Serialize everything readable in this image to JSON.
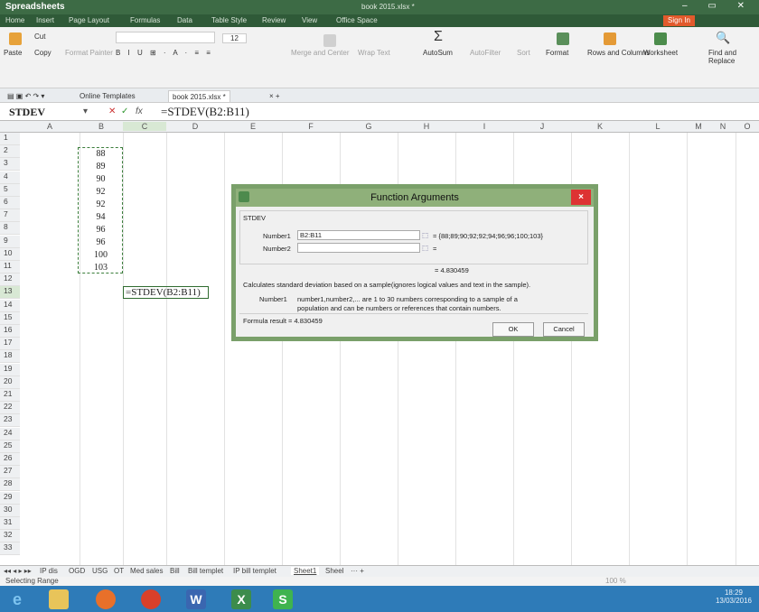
{
  "titlebar": {
    "app_name": "Spreadsheets",
    "doc_title": "book 2015.xlsx *"
  },
  "menu": {
    "items": [
      "Home",
      "Insert",
      "Page Layout",
      "Formulas",
      "Data",
      "Table Style",
      "Review",
      "View",
      "Office Space"
    ],
    "sign_in": "Sign In"
  },
  "ribbon": {
    "cut": "Cut",
    "copy": "Copy",
    "paste": "Paste",
    "format_painter": "Format Painter",
    "font_size": "12",
    "merge": "Merge and Center",
    "wrap": "Wrap Text",
    "autosum": "AutoSum",
    "autofilter": "AutoFilter",
    "sort": "Sort",
    "format": "Format",
    "rows_cols": "Rows and Columns",
    "worksheet": "Worksheet",
    "find": "Find and Replace"
  },
  "doc_tabs": [
    "Online Templates",
    "book 2015.xlsx *"
  ],
  "formula_bar": {
    "name_box": "STDEV",
    "formula": "=STDEV(B2:B11)"
  },
  "columns": [
    "A",
    "B",
    "C",
    "D",
    "E",
    "F",
    "G",
    "H",
    "I",
    "J",
    "K",
    "L",
    "M",
    "N",
    "O"
  ],
  "rows": [
    "1",
    "2",
    "3",
    "4",
    "5",
    "6",
    "7",
    "8",
    "9",
    "10",
    "11",
    "12",
    "13",
    "14",
    "15",
    "16",
    "17",
    "18",
    "19",
    "20",
    "21",
    "22",
    "23",
    "24",
    "25",
    "26",
    "27",
    "28",
    "29",
    "30",
    "31",
    "32",
    "33"
  ],
  "cells": {
    "b_values": [
      "88",
      "89",
      "90",
      "92",
      "92",
      "94",
      "96",
      "96",
      "100",
      "103"
    ],
    "c13": "=STDEV(B2:B11)"
  },
  "dialog": {
    "title": "Function Arguments",
    "function_name": "STDEV",
    "number1_label": "Number1",
    "number1_value": "B2:B11",
    "number1_result": "= {88;89;90;92;92;94;96;96;100;103}",
    "number2_label": "Number2",
    "number2_result": "=",
    "result_line": "= 4.830459",
    "description": "Calculates standard deviation based on a sample(ignores logical values and text in the sample).",
    "arg_name": "Number1",
    "arg_desc_1": "number1,number2,... are 1 to 30 numbers corresponding to a sample of a",
    "arg_desc_2": "population and can be numbers or references that contain numbers.",
    "formula_result": "Formula result = 4.830459",
    "ok": "OK",
    "cancel": "Cancel",
    "close": "×"
  },
  "sheet_tabs": [
    "IP dis",
    "OGD",
    "USG",
    "OT",
    "Med sales",
    "Bill",
    "Bill templet",
    "IP bill templet",
    "Sheet1",
    "Sheel"
  ],
  "status": {
    "text": "Selecting Range",
    "zoom": "100 %"
  },
  "clock": {
    "time": "18:29",
    "date": "13/03/2016"
  },
  "colors": {
    "accent": "#3d6b45",
    "dialog_border": "#7aa06a",
    "taskbar": "#2e7bb8"
  }
}
